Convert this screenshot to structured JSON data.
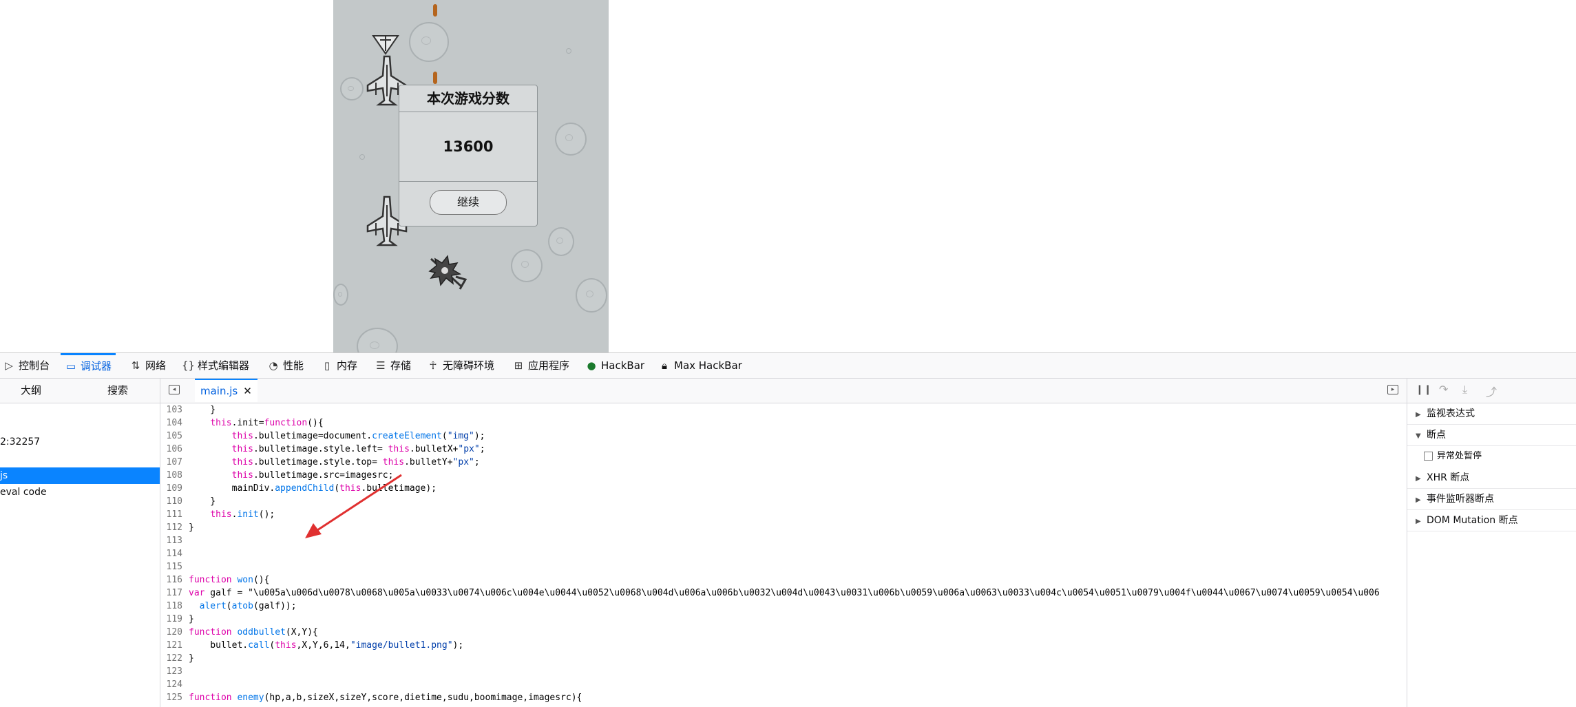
{
  "game": {
    "dialog_title": "本次游戏分数",
    "score": "13600",
    "continue_label": "继续"
  },
  "devtools": {
    "tabs": [
      {
        "label": "控制台",
        "icon": "console-icon"
      },
      {
        "label": "调试器",
        "icon": "debugger-icon"
      },
      {
        "label": "网络",
        "icon": "network-icon"
      },
      {
        "label": "样式编辑器",
        "icon": "style-editor-icon"
      },
      {
        "label": "性能",
        "icon": "performance-icon"
      },
      {
        "label": "内存",
        "icon": "memory-icon"
      },
      {
        "label": "存储",
        "icon": "storage-icon"
      },
      {
        "label": "无障碍环境",
        "icon": "accessibility-icon"
      },
      {
        "label": "应用程序",
        "icon": "application-icon"
      },
      {
        "label": "HackBar",
        "icon": "hackbar-icon"
      },
      {
        "label": "Max HackBar",
        "icon": "max-hackbar-icon"
      }
    ],
    "left_panel": {
      "tab_outline": "大纲",
      "tab_search": "搜索",
      "items": [
        "2:32257",
        "js",
        "eval code"
      ]
    },
    "file_tab": "main.js",
    "right_panel": {
      "watch": "监视表达式",
      "breakpoints": "断点",
      "pause_on_exceptions": "异常处暂停",
      "xhr": "XHR 断点",
      "event_listener": "事件监听器断点",
      "dom_mutation": "DOM Mutation 断点"
    },
    "code": {
      "lines": [
        {
          "n": "103",
          "text": "    }"
        },
        {
          "n": "104",
          "text": "    this.init=function(){"
        },
        {
          "n": "105",
          "text": "        this.bulletimage=document.createElement(\"img\");"
        },
        {
          "n": "106",
          "text": "        this.bulletimage.style.left= this.bulletX+\"px\";"
        },
        {
          "n": "107",
          "text": "        this.bulletimage.style.top= this.bulletY+\"px\";"
        },
        {
          "n": "108",
          "text": "        this.bulletimage.src=imagesrc;"
        },
        {
          "n": "109",
          "text": "        mainDiv.appendChild(this.bulletimage);"
        },
        {
          "n": "110",
          "text": "    }"
        },
        {
          "n": "111",
          "text": "    this.init();"
        },
        {
          "n": "112",
          "text": "}"
        },
        {
          "n": "113",
          "text": ""
        },
        {
          "n": "114",
          "text": ""
        },
        {
          "n": "115",
          "text": ""
        },
        {
          "n": "116",
          "text": "function won(){"
        },
        {
          "n": "117",
          "text": "var galf = \"\\u005a\\u006d\\u0078\\u0068\\u005a\\u0033\\u0074\\u006c\\u004e\\u0044\\u0052\\u0068\\u004d\\u006a\\u006b\\u0032\\u004d\\u0043\\u0031\\u006b\\u0059\\u006a\\u0063\\u0033\\u004c\\u0054\\u0051\\u0079\\u004f\\u0044\\u0067\\u0074\\u0059\\u0054\\u006"
        },
        {
          "n": "118",
          "text": "  alert(atob(galf));"
        },
        {
          "n": "119",
          "text": "}"
        },
        {
          "n": "120",
          "text": "function oddbullet(X,Y){"
        },
        {
          "n": "121",
          "text": "    bullet.call(this,X,Y,6,14,\"image/bullet1.png\");"
        },
        {
          "n": "122",
          "text": "}"
        },
        {
          "n": "123",
          "text": ""
        },
        {
          "n": "124",
          "text": ""
        },
        {
          "n": "125",
          "text": "function enemy(hp,a,b,sizeX,sizeY,score,dietime,sudu,boomimage,imagesrc){"
        }
      ]
    }
  }
}
